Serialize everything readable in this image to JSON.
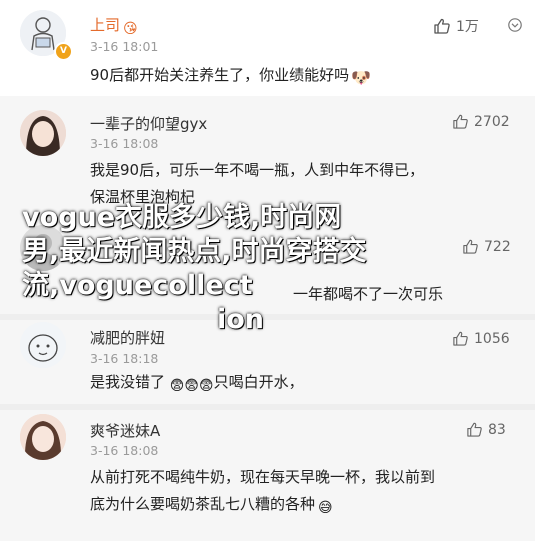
{
  "post": {
    "user": "上司",
    "user_badge": "😘",
    "time": "3-16 18:01",
    "text": "90后都开始关注养生了，你业绩能好吗",
    "likes": "1万",
    "name_color": "#e46b2c"
  },
  "comments": [
    {
      "user": "一辈子的仰望gyx",
      "time": "3-16 18:08",
      "likes": "2702",
      "text_lines": [
        "我是90后，可乐一年不喝一瓶，人到中年不得已，",
        "保温杯里泡枸杞"
      ]
    },
    {
      "user": "",
      "time": "",
      "likes": "722",
      "text_lines": [
        "一年都喝不了一次可乐"
      ]
    },
    {
      "user": "减肥的胖妞",
      "time": "3-16 18:18",
      "likes": "1056",
      "text_lines": [
        "是我没错了",
        "只喝白开水，"
      ]
    },
    {
      "user": "爽爷迷妹A",
      "time": "3-16 18:08",
      "likes": "83",
      "text_lines": [
        "从前打死不喝纯牛奶，现在每天早晚一杯，我以前到",
        "底为什么要喝奶茶乱七八糟的各种"
      ]
    }
  ],
  "overlay_text": "vogue衣服多少钱,时尚网男,最近新闻热点,时尚穿搭交流,voguecollection",
  "overlay_lines": [
    "vogue衣服多少钱,时尚网",
    "男,最近新闻热点,时尚穿搭交",
    "流,voguecollect",
    "ion"
  ],
  "icons": [
    "thumb-up-icon",
    "chevron-down-icon",
    "verified-badge-icon",
    "avatar"
  ],
  "colors": {
    "name_normal": "#333333",
    "name_highlight": "#e46b2c",
    "background": "#f6f6f6"
  }
}
